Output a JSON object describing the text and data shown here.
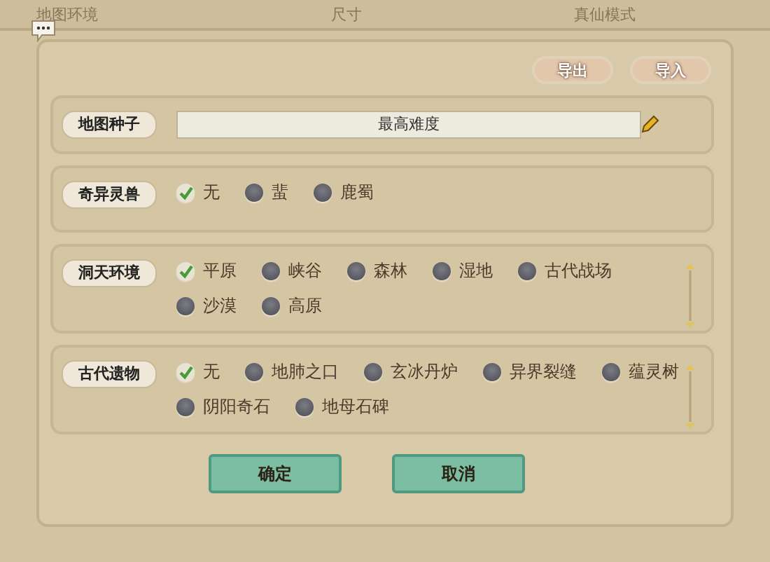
{
  "background_bar": {
    "items": [
      "地图环境",
      "尺寸",
      "真仙模式"
    ]
  },
  "actions": [
    "导出",
    "导入"
  ],
  "sections": [
    {
      "kind": "input",
      "label": "地图种子",
      "value": "最高难度"
    },
    {
      "kind": "options",
      "label": "奇异灵兽",
      "scrollable": false,
      "options": [
        {
          "label": "无",
          "selected": true
        },
        {
          "label": "蜚",
          "selected": false
        },
        {
          "label": "鹿蜀",
          "selected": false
        }
      ]
    },
    {
      "kind": "options",
      "label": "洞天环境",
      "scrollable": true,
      "options": [
        {
          "label": "平原",
          "selected": true
        },
        {
          "label": "峡谷",
          "selected": false
        },
        {
          "label": "森林",
          "selected": false
        },
        {
          "label": "湿地",
          "selected": false
        },
        {
          "label": "古代战场",
          "selected": false
        },
        {
          "label": "沙漠",
          "selected": false
        },
        {
          "label": "高原",
          "selected": false
        }
      ]
    },
    {
      "kind": "options",
      "label": "古代遗物",
      "scrollable": true,
      "options": [
        {
          "label": "无",
          "selected": true
        },
        {
          "label": "地肺之口",
          "selected": false
        },
        {
          "label": "玄冰丹炉",
          "selected": false
        },
        {
          "label": "异界裂缝",
          "selected": false
        },
        {
          "label": "蕴灵树",
          "selected": false
        },
        {
          "label": "阴阳奇石",
          "selected": false
        },
        {
          "label": "地母石碑",
          "selected": false
        }
      ]
    }
  ],
  "buttons": [
    "确定",
    "取消"
  ]
}
